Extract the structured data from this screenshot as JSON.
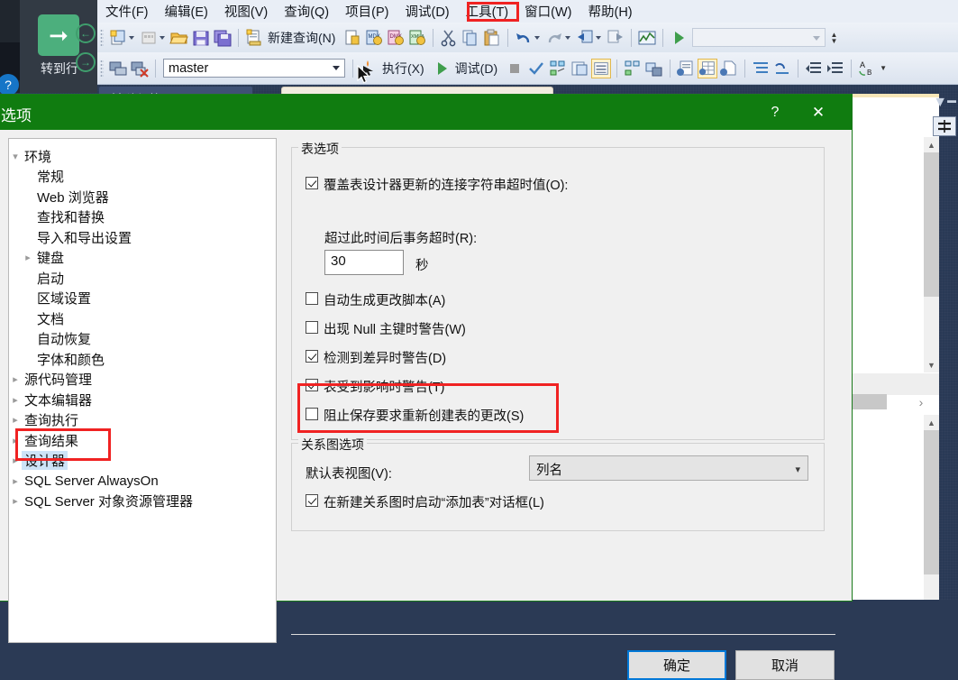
{
  "app": {
    "menus": [
      {
        "label": "文件(F)"
      },
      {
        "label": "编辑(E)"
      },
      {
        "label": "视图(V)"
      },
      {
        "label": "查询(Q)"
      },
      {
        "label": "项目(P)"
      },
      {
        "label": "调试(D)"
      },
      {
        "label": "工具(T)",
        "highlighted": true
      },
      {
        "label": "窗口(W)"
      },
      {
        "label": "帮助(H)"
      }
    ],
    "toolbar1": {
      "new_query_label": "新建查询(N)",
      "icons": [
        "new-project-icon",
        "new-item-icon",
        "open-file-icon",
        "save-icon",
        "save-all-icon",
        "new-query-icon",
        "new-query-current-connection-icon",
        "new-analysis-services-mdx-query-icon",
        "new-analysis-services-dmx-query-icon",
        "new-analysis-services-xmla-query-icon",
        "cut-icon",
        "copy-icon",
        "paste-icon",
        "undo-icon",
        "redo-icon",
        "navigate-backward-icon",
        "navigate-forward-icon",
        "activity-monitor-icon",
        "run-icon"
      ]
    },
    "toolbar2": {
      "database_value": "master",
      "execute_label": "执行(X)",
      "debug_label": "调试(D)",
      "icons": [
        "connect-icon",
        "disconnect-icon",
        "available-databases-combo",
        "pointer-icon",
        "execute-icon",
        "debug-icon",
        "stop-icon",
        "parse-icon",
        "display-estimated-plan-icon",
        "query-options-icon",
        "include-actual-plan-icon",
        "include-client-statistics-icon",
        "results-to-text-icon",
        "results-to-grid-icon",
        "results-to-file-icon",
        "comment-icon",
        "uncomment-icon",
        "decrease-indent-icon",
        "increase-indent-icon",
        "find-replace-icon"
      ]
    },
    "left_panel": {
      "goto_label": "转到行",
      "goto_icon": "arrow-right-icon",
      "back_icon": "back-circle-icon",
      "forward_icon": "forward-circle-icon",
      "help_icon": "help-circle-icon"
    },
    "background_tabs": {
      "object_explorer": "对象资源管理器"
    }
  },
  "dialog": {
    "title": "选项",
    "help_icon": "question-mark-icon",
    "close_icon": "close-icon",
    "tree": [
      {
        "label": "环境",
        "level": 0,
        "arrow": "expanded",
        "selected": false
      },
      {
        "label": "常规",
        "level": 1,
        "arrow": "none",
        "selected": false
      },
      {
        "label": "Web 浏览器",
        "level": 1,
        "arrow": "none",
        "selected": false
      },
      {
        "label": "查找和替换",
        "level": 1,
        "arrow": "none",
        "selected": false
      },
      {
        "label": "导入和导出设置",
        "level": 1,
        "arrow": "none",
        "selected": false
      },
      {
        "label": "键盘",
        "level": 1,
        "arrow": "collapsed",
        "selected": false
      },
      {
        "label": "启动",
        "level": 1,
        "arrow": "none",
        "selected": false
      },
      {
        "label": "区域设置",
        "level": 1,
        "arrow": "none",
        "selected": false
      },
      {
        "label": "文档",
        "level": 1,
        "arrow": "none",
        "selected": false
      },
      {
        "label": "自动恢复",
        "level": 1,
        "arrow": "none",
        "selected": false
      },
      {
        "label": "字体和颜色",
        "level": 1,
        "arrow": "none",
        "selected": false
      },
      {
        "label": "源代码管理",
        "level": 0,
        "arrow": "collapsed",
        "selected": false
      },
      {
        "label": "文本编辑器",
        "level": 0,
        "arrow": "collapsed",
        "selected": false
      },
      {
        "label": "查询执行",
        "level": 0,
        "arrow": "collapsed",
        "selected": false
      },
      {
        "label": "查询结果",
        "level": 0,
        "arrow": "collapsed",
        "selected": false
      },
      {
        "label": "设计器",
        "level": 0,
        "arrow": "collapsed",
        "selected": true
      },
      {
        "label": "SQL Server AlwaysOn",
        "level": 0,
        "arrow": "collapsed",
        "selected": false
      },
      {
        "label": "SQL Server 对象资源管理器",
        "level": 0,
        "arrow": "collapsed",
        "selected": false
      }
    ],
    "table_options": {
      "group_title": "表选项",
      "override_timeout": {
        "label": "覆盖表设计器更新的连接字符串超时值(O):",
        "checked": true
      },
      "transaction_timeout_label": "超过此时间后事务超时(R):",
      "timeout_value": "30",
      "seconds_label": "秒",
      "checkboxes": [
        {
          "label": "自动生成更改脚本(A)",
          "checked": false
        },
        {
          "label": "出现 Null 主键时警告(W)",
          "checked": false
        },
        {
          "label": "检测到差异时警告(D)",
          "checked": true
        },
        {
          "label": "表受到影响时警告(T)",
          "checked": true
        },
        {
          "label": "阻止保存要求重新创建表的更改(S)",
          "checked": false,
          "highlighted": true
        }
      ]
    },
    "diagram_options": {
      "group_title": "关系图选项",
      "default_view_label": "默认表视图(V):",
      "default_view_value": "列名",
      "launch_add_table": {
        "label": "在新建关系图时启动“添加表”对话框(L)",
        "checked": true
      }
    },
    "buttons": {
      "ok": "确定",
      "cancel": "取消"
    }
  },
  "annotations": {
    "accent_red": "#f02222",
    "title_green": "#107c10",
    "focus_blue": "#0078d7",
    "selection_blue": "#cde3f7"
  }
}
